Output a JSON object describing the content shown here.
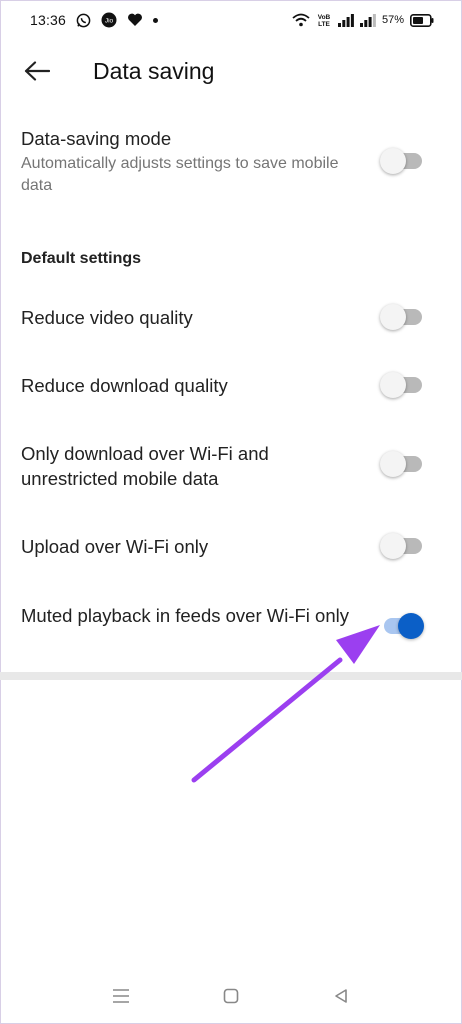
{
  "status_bar": {
    "time": "13:36",
    "battery": "57%",
    "icons": [
      "whatsapp-icon",
      "jio-icon",
      "heart-app-icon",
      "wifi-icon",
      "volte-icon",
      "signal-icon",
      "signal-icon",
      "battery-icon"
    ],
    "volte_label": "VoLTE"
  },
  "header": {
    "title": "Data saving",
    "back_icon": "back-arrow-icon"
  },
  "data_saving_mode": {
    "label": "Data-saving mode",
    "description": "Automatically adjusts settings to save mobile data",
    "enabled": false
  },
  "section": {
    "title": "Default settings"
  },
  "settings": [
    {
      "label": "Reduce video quality",
      "enabled": false
    },
    {
      "label": "Reduce download quality",
      "enabled": false
    },
    {
      "label": "Only download over Wi-Fi and unrestricted mobile data",
      "enabled": false
    },
    {
      "label": "Upload over Wi-Fi only",
      "enabled": false
    },
    {
      "label": "Muted playback in feeds over Wi-Fi only",
      "enabled": true
    }
  ],
  "colors": {
    "toggle_on": "#0b5fc7",
    "toggle_on_track": "#a9c6f0",
    "toggle_off_track": "#b9b9b9",
    "annotation_arrow": "#9b3ff0"
  },
  "nav_bar": {
    "icons": [
      "menu-icon",
      "home-square-icon",
      "back-triangle-icon"
    ]
  }
}
